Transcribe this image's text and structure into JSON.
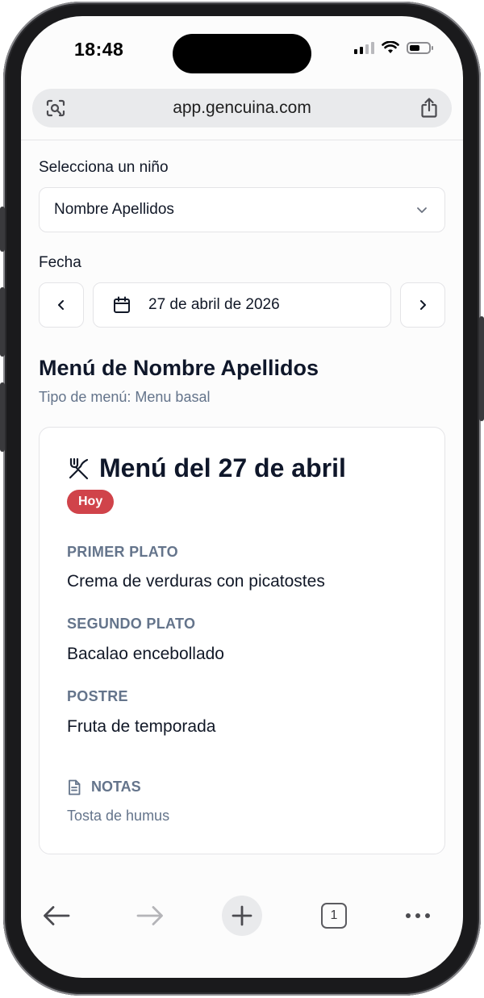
{
  "status_bar": {
    "time": "18:48",
    "icons": [
      "cellular-signal-icon",
      "wifi-icon",
      "battery-icon"
    ]
  },
  "browser": {
    "url": "app.gencuina.com",
    "left_icon": "camera-search-icon",
    "share_icon": "share-icon",
    "toolbar": {
      "back_icon": "back-arrow-icon",
      "forward_icon": "forward-arrow-icon",
      "new_tab_icon": "plus-icon",
      "tab_count": "1",
      "more_icon": "more-icon"
    }
  },
  "form": {
    "child_label": "Selecciona un niño",
    "child_value": "Nombre Apellidos",
    "date_label": "Fecha",
    "date_value": "27 de abril de 2026"
  },
  "menu": {
    "title": "Menú de Nombre Apellidos",
    "type": "Tipo de menú: Menu basal",
    "card": {
      "title": "Menú del 27 de abril",
      "badge": "Hoy",
      "sections": [
        {
          "label": "PRIMER PLATO",
          "value": "Crema de verduras con picatostes"
        },
        {
          "label": "SEGUNDO PLATO",
          "value": "Bacalao encebollado"
        },
        {
          "label": "POSTRE",
          "value": "Fruta de temporada"
        }
      ],
      "notes_label": "NOTAS",
      "notes_value": "Tosta de humus"
    }
  },
  "colors": {
    "badge": "#d0434a",
    "muted_text": "#64748b",
    "border": "#e4e4e7"
  }
}
